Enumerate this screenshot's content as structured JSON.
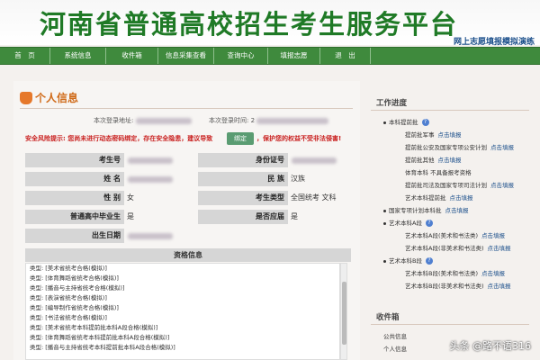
{
  "banner": {
    "title": "河南省普通高校招生考生服务平台",
    "subtitle": "网上志愿填报模拟演练"
  },
  "nav": [
    {
      "label": "首　页",
      "w": 56
    },
    {
      "label": "系统信息",
      "w": 62
    },
    {
      "label": "收件箱",
      "w": 58
    },
    {
      "label": "信息采集查看",
      "w": 62
    },
    {
      "label": "查询中心",
      "w": 60
    },
    {
      "label": "填报志愿",
      "w": 58
    },
    {
      "label": "退　出",
      "w": 56
    }
  ],
  "profile": {
    "title": "个人信息",
    "login_addr_label": "本次登录地址:",
    "login_time_label": "本次登录时间: 2",
    "warn_text": "安全风险提示: 您尚未进行动态密码绑定，存在安全隐患，建议导致",
    "bind_button": "绑定",
    "warn_text2": "，保护您的权益不受非法侵害!",
    "rows": [
      {
        "l1": "考生号",
        "v1": "",
        "l2": "身份证号",
        "v2": ""
      },
      {
        "l1": "姓 名",
        "v1": "",
        "l2": "民 族",
        "v2": "汉族"
      },
      {
        "l1": "性 别",
        "v1": "女",
        "l2": "考生类型",
        "v2": "全国统考 文科"
      },
      {
        "l1": "普通高中毕业生",
        "v1": "是",
        "l2": "是否应届",
        "v2": "是"
      },
      {
        "l1": "出生日期",
        "v1": "",
        "l2": "",
        "v2": ""
      }
    ],
    "qual_header": "资格信息",
    "qual_items": [
      "类型: [美术省统考合格(模拟)]",
      "类型: [体育舞蹈省统考合格(模拟)]",
      "类型: [播音与主持省统考合格(模拟)]",
      "类型: [表演省统考合格(模拟)]",
      "类型: [编导制作省统考合格(模拟)]",
      "类型: [书法省统考合格(模拟)]",
      "类型: [美术省统考本科提前批本科A段合格(模拟)]",
      "类型: [体育舞蹈省统考本科提前批本科A段合格(模拟)]",
      "类型: [播音与主持省统考本科提前批本科A段合格(模拟)]"
    ]
  },
  "right": {
    "progress_title": "工作进度",
    "tree": [
      {
        "text": "本科提前批",
        "bullet": true,
        "help": true,
        "link": ""
      },
      {
        "text": "提前批军事",
        "bullet": false,
        "help": false,
        "link": "点击填报"
      },
      {
        "text": "提前批公安及国家专项公安计划",
        "bullet": false,
        "help": false,
        "link": "点击填报"
      },
      {
        "text": "提前批其他",
        "bullet": false,
        "help": false,
        "link": "点击填报"
      },
      {
        "text": "体育本科 不具备报考资格",
        "bullet": false,
        "help": false,
        "link": ""
      },
      {
        "text": "提前批司法及国家专项司法计划",
        "bullet": false,
        "help": false,
        "link": "点击填报"
      },
      {
        "text": "艺术本科提前批",
        "bullet": false,
        "help": false,
        "link": "点击填报"
      },
      {
        "text": "国家专项计划本科批",
        "bullet": true,
        "help": false,
        "link": "点击填报"
      },
      {
        "text": "艺术本科A段",
        "bullet": true,
        "help": true,
        "link": ""
      },
      {
        "text": "艺术本科A段(美术和书法类)",
        "bullet": false,
        "help": false,
        "link": "点击填报"
      },
      {
        "text": "艺术本科A段(非美术和书法类)",
        "bullet": false,
        "help": false,
        "link": "点击填报"
      },
      {
        "text": "艺术本科B段",
        "bullet": true,
        "help": true,
        "link": ""
      },
      {
        "text": "艺术本科B段(美术和书法类)",
        "bullet": false,
        "help": false,
        "link": "点击填报"
      },
      {
        "text": "艺术本科B段(非美术和书法类)",
        "bullet": false,
        "help": false,
        "link": "点击填报"
      }
    ],
    "inbox_title": "收件箱",
    "inbox_items": [
      "公共信息",
      "个人信息"
    ]
  },
  "watermark": "头条 @路不语316",
  "colors": {
    "brand_green": "#1f7a26",
    "nav_green": "#3f8a3d",
    "warning_red": "#c9201f",
    "title_orange": "#d06b1a",
    "link_blue": "#1a4e8a"
  }
}
